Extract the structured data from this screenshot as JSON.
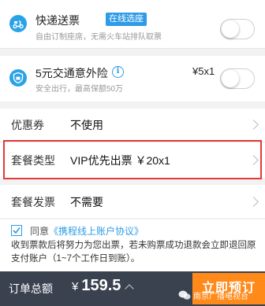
{
  "express": {
    "title": "快递送票",
    "tag": "在线选座",
    "subtitle": "自由订制座席，无需火车站排队取票",
    "icon": "delivery-scooter-icon"
  },
  "insurance": {
    "title": "5元交通意外险",
    "subtitle": "安全出行，最高保额50万",
    "price": "¥5x1",
    "icon": "shield-icon",
    "info_symbol": "i"
  },
  "options": [
    {
      "label": "优惠券",
      "value": "不使用"
    },
    {
      "label": "套餐类型",
      "value": "VIP优先出票 ￥20x1"
    },
    {
      "label": "套餐发票",
      "value": "不需要"
    }
  ],
  "agreement": {
    "prefix": "同意",
    "link": "《携程线上账户协议》",
    "note": "收到票款后将努力为您出票，若未购票成功退款会立即退回原支付账户（1~7个工作日到账）。"
  },
  "footer": {
    "total_label": "订单总额",
    "currency": "¥",
    "total": "159.5",
    "book_label": "立即预订",
    "watermark": "南京广播电视台"
  },
  "colors": {
    "accent": "#2e9be6",
    "book_button": "#ff8a1a",
    "highlight": "#e23a3a",
    "bottom_bar": "#3a4250"
  }
}
